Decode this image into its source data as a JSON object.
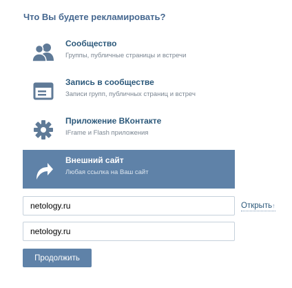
{
  "title": "Что Вы будете рекламировать?",
  "options": [
    {
      "name": "Сообщество",
      "desc": "Группы, публичные страницы и встречи",
      "icon": "community-icon"
    },
    {
      "name": "Запись в сообществе",
      "desc": "Записи групп, публичных страниц и встреч",
      "icon": "post-icon"
    },
    {
      "name": "Приложение ВКонтакте",
      "desc": "IFrame и Flash приложения",
      "icon": "gear-icon"
    },
    {
      "name": "Внешний сайт",
      "desc": "Любая ссылка на Ваш сайт",
      "icon": "external-link-arrow-icon",
      "selected": true
    }
  ],
  "site_url": {
    "value": "netology.ru"
  },
  "open_link": {
    "label": "Открыть",
    "arrow": "↑"
  },
  "second_url": {
    "value": "netology.ru"
  },
  "continue_label": "Продолжить",
  "colors": {
    "accent": "#5f82a8",
    "title": "#45678f",
    "link": "#2b587a",
    "icon": "#5f7a97"
  }
}
